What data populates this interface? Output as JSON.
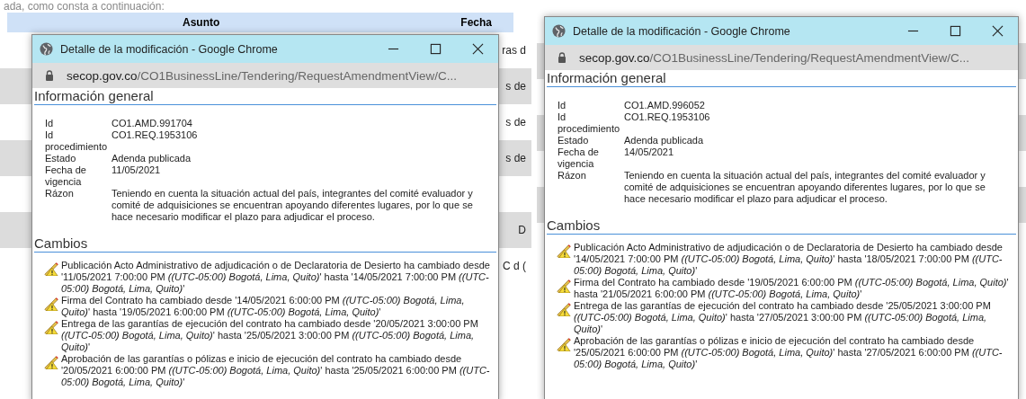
{
  "panels": [
    {
      "page": {
        "intro": "ada, como consta a continuación:",
        "columns": [
          "Asunto",
          "Fecha"
        ],
        "rows": [
          {
            "text": "ras d"
          },
          {
            "text": "s de"
          },
          {
            "text": "s de"
          },
          {
            "text": "s de"
          },
          {},
          {
            "text": "D"
          },
          {
            "text": "C d ("
          }
        ]
      },
      "popup": {
        "title": "Detalle de la modificación - Google Chrome",
        "url_host": "secop.gov.co",
        "url_path": "/CO1BusinessLine/Tendering/RequestAmendmentView/C...",
        "section_general": "Información general",
        "fields": [
          {
            "label": "Id",
            "value": "CO1.AMD.991704"
          },
          {
            "label": "Id procedimiento",
            "value": "CO1.REQ.1953106"
          },
          {
            "label": "Estado",
            "value": "Adenda publicada"
          },
          {
            "label": "Fecha de vigencia",
            "value": "11/05/2021"
          },
          {
            "label": "Rázon",
            "value": "Teniendo en cuenta la situación actual del país, integrantes del comité evaluador y comité de adquisiciones se encuentran apoyando diferentes lugares, por lo que se hace necesario modificar el plazo para adjudicar el proceso."
          }
        ],
        "section_changes": "Cambios",
        "changes": [
          "Publicación Acto Administrativo de adjudicación o de Declaratoria de Desierto ha cambiado desde '11/05/2021 7:00:00 PM *((UTC-05:00) Bogotá, Lima, Quito)*' hasta '14/05/2021 7:00:00 PM *((UTC-05:00) Bogotá, Lima, Quito)*'",
          "Firma del Contrato ha cambiado desde '14/05/2021 6:00:00 PM *((UTC-05:00) Bogotá, Lima, Quito)*' hasta '19/05/2021 6:00:00 PM *((UTC-05:00) Bogotá, Lima, Quito)*'",
          "Entrega de las garantías de ejecución del contrato ha cambiado desde '20/05/2021 3:00:00 PM *((UTC-05:00) Bogotá, Lima, Quito)*' hasta '25/05/2021 3:00:00 PM *((UTC-05:00) Bogotá, Lima, Quito)*'",
          "Aprobación de las garantías o pólizas e inicio de ejecución del contrato ha cambiado desde '20/05/2021 6:00:00 PM *((UTC-05:00) Bogotá, Lima, Quito)*' hasta '25/05/2021 6:00:00 PM *((UTC-05:00) Bogotá, Lima, Quito)*'"
        ]
      }
    },
    {
      "page": {
        "rows": [
          {},
          {},
          {},
          {},
          {},
          {}
        ]
      },
      "popup": {
        "title": "Detalle de la modificación - Google Chrome",
        "url_host": "secop.gov.co",
        "url_path": "/CO1BusinessLine/Tendering/RequestAmendmentView/C...",
        "section_general": "Información general",
        "fields": [
          {
            "label": "Id",
            "value": "CO1.AMD.996052"
          },
          {
            "label": "Id procedimiento",
            "value": "CO1.REQ.1953106"
          },
          {
            "label": "Estado",
            "value": "Adenda publicada"
          },
          {
            "label": "Fecha de vigencia",
            "value": "14/05/2021"
          },
          {
            "label": "Rázon",
            "value": "Teniendo en cuenta la situación actual del país, integrantes del comité evaluador y comité de adquisiciones se encuentran apoyando diferentes lugares, por lo que se hace necesario modificar el plazo para adjudicar el proceso."
          }
        ],
        "section_changes": "Cambios",
        "changes": [
          "Publicación Acto Administrativo de adjudicación o de Declaratoria de Desierto ha cambiado desde '14/05/2021 7:00:00 PM *((UTC-05:00) Bogotá, Lima, Quito)*' hasta '18/05/2021 7:00:00 PM *((UTC-05:00) Bogotá, Lima, Quito)*'",
          "Firma del Contrato ha cambiado desde '19/05/2021 6:00:00 PM *((UTC-05:00) Bogotá, Lima, Quito)*' hasta '21/05/2021 6:00:00 PM *((UTC-05:00) Bogotá, Lima, Quito)*'",
          "Entrega de las garantías de ejecución del contrato ha cambiado desde '25/05/2021 3:00:00 PM *((UTC-05:00) Bogotá, Lima, Quito)*' hasta '27/05/2021 3:00:00 PM *((UTC-05:00) Bogotá, Lima, Quito)*'",
          "Aprobación de las garantías o pólizas e inicio de ejecución del contrato ha cambiado desde '25/05/2021 6:00:00 PM *((UTC-05:00) Bogotá, Lima, Quito)*' hasta '27/05/2021 6:00:00 PM *((UTC-05:00) Bogotá, Lima, Quito)*'"
        ]
      }
    }
  ]
}
